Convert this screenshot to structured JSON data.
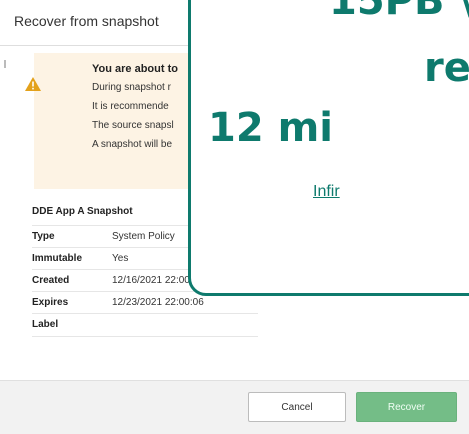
{
  "dialog": {
    "title": "Recover from snapshot"
  },
  "warning": {
    "title": "You are about to",
    "lines": [
      "During snapshot r",
      "It is recommende",
      "The source snapsl",
      "A snapshot will be"
    ],
    "color": "#e3a11b"
  },
  "details": {
    "heading": "DDE App A Snapshot",
    "rows": [
      {
        "key": "Type",
        "value": "System Policy"
      },
      {
        "key": "Immutable",
        "value": "Yes"
      },
      {
        "key": "Created",
        "value": "12/16/2021 22:00:06"
      },
      {
        "key": "Expires",
        "value": "12/23/2021 22:00:06"
      },
      {
        "key": "Label",
        "value": ""
      }
    ]
  },
  "footer": {
    "cancel_label": "Cancel",
    "recover_label": "Recover"
  },
  "overlay": {
    "line1": "15PB \\",
    "line2": "re",
    "line3": "12 mi",
    "link": "Infir",
    "accent": "#0e7a6d"
  }
}
